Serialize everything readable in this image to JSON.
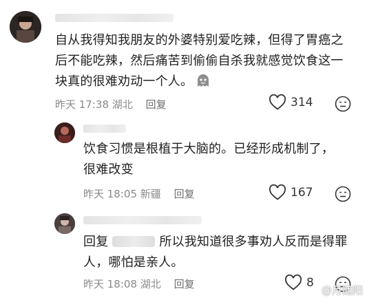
{
  "comments": [
    {
      "text_lines": [
        "自从我得知我朋友的外婆特别爱吃辣，但得了胃癌之",
        "后不能吃辣，然后痛苦到偷偷自杀我就感觉饮食这一",
        "块真的很难劝动一个人。"
      ],
      "time": "昨天 17:38",
      "location": "湖北",
      "reply_label": "回复",
      "likes": "314"
    },
    {
      "text_lines": [
        "饮食习惯是根植于大脑的。已经形成机制了，",
        "很难改变"
      ],
      "time": "昨天 18:05",
      "location": "新疆",
      "reply_label": "回复",
      "likes": "167"
    },
    {
      "reply_prefix": "回复",
      "text_lines": [
        "所以我知道很多事劝人反而是得罪",
        "人，哪怕是亲人。"
      ],
      "time": "昨天 18:08",
      "location": "湖北",
      "reply_label": "回复",
      "likes": "8"
    }
  ],
  "icons": {
    "like": "heart-outline-icon",
    "dislike": "meh-face-icon",
    "emoji": "ghost-face-emoji"
  },
  "watermark": "@月随阳",
  "colors": {
    "text": "#1f1f1f",
    "meta": "#8a8a8a",
    "background": "#ffffff"
  }
}
